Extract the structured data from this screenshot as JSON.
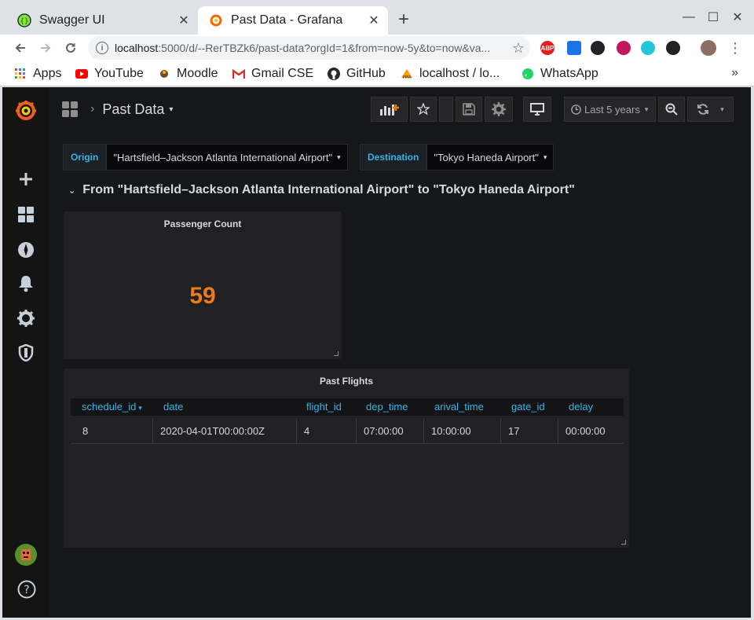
{
  "browser": {
    "tabs": [
      {
        "title": "Swagger UI",
        "close": "✕"
      },
      {
        "title": "Past Data - Grafana",
        "close": "✕"
      }
    ],
    "new_tab": "+",
    "window_controls": {
      "minimize": "—",
      "maximize": "☐",
      "close": "✕"
    },
    "url_host": "localhost",
    "url_path": ":5000/d/--RerTBZk6/past-data?orgId=1&from=now-5y&to=now&va...",
    "extensions": [
      "ABP"
    ],
    "bookmarks": [
      {
        "label": "Apps",
        "icon": "apps-grid-icon"
      },
      {
        "label": "YouTube",
        "icon": "youtube-icon"
      },
      {
        "label": "Moodle",
        "icon": "moodle-icon"
      },
      {
        "label": "Gmail CSE",
        "icon": "gmail-icon"
      },
      {
        "label": "GitHub",
        "icon": "github-icon"
      },
      {
        "label": "localhost / lo...",
        "icon": "phpmyadmin-icon"
      },
      {
        "label": "WhatsApp",
        "icon": "whatsapp-icon"
      }
    ],
    "bookmarks_overflow": "»"
  },
  "dashboard": {
    "breadcrumb_separator": "›",
    "title": "Past Data",
    "title_caret": "▾",
    "time_range": "Last 5 years",
    "time_range_caret": "▾",
    "refresh_caret": "▾",
    "variables": [
      {
        "label": "Origin",
        "value": "\"Hartsfield–Jackson Atlanta International Airport\"",
        "caret": "▾"
      },
      {
        "label": "Destination",
        "value": "\"Tokyo Haneda Airport\"",
        "caret": "▾"
      }
    ],
    "row_chevron": "⌄",
    "row_title": "From \"Hartsfield–Jackson Atlanta International Airport\" to \"Tokyo Haneda Airport\"",
    "stat_panel": {
      "title": "Passenger Count",
      "value": "59",
      "value_color": "#eb7b18"
    },
    "table_panel": {
      "title": "Past Flights",
      "sort_indicator": "▾",
      "columns": [
        "schedule_id",
        "date",
        "flight_id",
        "dep_time",
        "arival_time",
        "gate_id",
        "delay"
      ],
      "rows": [
        [
          "8",
          "2020-04-01T00:00:00Z",
          "4",
          "07:00:00",
          "10:00:00",
          "17",
          "00:00:00"
        ]
      ]
    }
  },
  "colors": {
    "grafana_bg": "#161719",
    "panel_bg": "#212124",
    "link_blue": "#33b5e5",
    "stat_orange": "#eb7b18"
  }
}
